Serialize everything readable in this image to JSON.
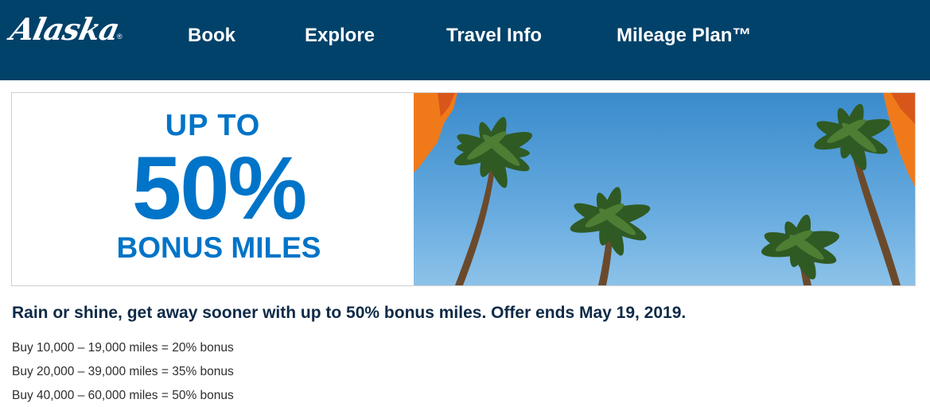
{
  "header": {
    "logo_text": "Alaska",
    "logo_mark": "®",
    "nav": [
      {
        "label": "Book"
      },
      {
        "label": "Explore"
      },
      {
        "label": "Travel Info"
      },
      {
        "label": "Mileage Plan™"
      }
    ]
  },
  "hero": {
    "line1": "UP TO",
    "line2": "50%",
    "line3": "BONUS MILES",
    "image_subject": "palm-trees-blue-sky"
  },
  "offer": {
    "headline": "Rain or shine, get away sooner with up to 50% bonus miles. Offer ends May 19, 2019.",
    "tiers": [
      "Buy 10,000 – 19,000 miles = 20% bonus",
      "Buy 20,000 – 39,000 miles = 35% bonus",
      "Buy 40,000 – 60,000 miles = 50% bonus"
    ]
  },
  "colors": {
    "nav_bg": "#01426a",
    "promo_blue": "#0074c8",
    "headline_navy": "#0e2a47",
    "sky": "#5ea6dc",
    "flag_orange": "#f07a1a"
  }
}
